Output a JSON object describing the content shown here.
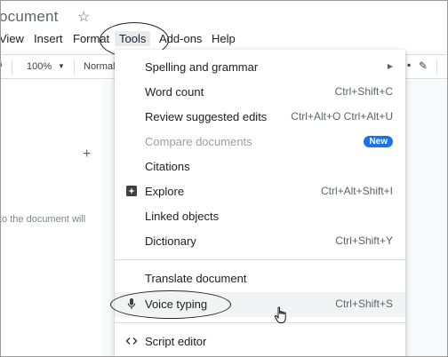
{
  "doc": {
    "title": "ocument"
  },
  "menubar": {
    "view": "View",
    "insert": "Insert",
    "format": "Format",
    "tools": "Tools",
    "addons": "Add-ons",
    "help": "Help"
  },
  "toolbar": {
    "zoom": "100%",
    "style": "Normal"
  },
  "outline": {
    "hint": "to the document will"
  },
  "tools_menu": {
    "items": [
      {
        "label": "Spelling and grammar",
        "shortcut": ""
      },
      {
        "label": "Word count",
        "shortcut": "Ctrl+Shift+C"
      },
      {
        "label": "Review suggested edits",
        "shortcut": "Ctrl+Alt+O Ctrl+Alt+U"
      },
      {
        "label": "Compare documents",
        "badge": "New"
      },
      {
        "label": "Citations",
        "shortcut": ""
      },
      {
        "label": "Explore",
        "shortcut": "Ctrl+Alt+Shift+I"
      },
      {
        "label": "Linked objects",
        "shortcut": ""
      },
      {
        "label": "Dictionary",
        "shortcut": "Ctrl+Shift+Y"
      },
      {
        "label": "Translate document",
        "shortcut": ""
      },
      {
        "label": "Voice typing",
        "shortcut": "Ctrl+Shift+S"
      },
      {
        "label": "Script editor",
        "shortcut": ""
      }
    ]
  },
  "colors": {
    "badge": "#1a73e8",
    "hover": "#f1f3f4",
    "disabled": "#9aa0a6"
  },
  "icons": {
    "explore": "explore-icon",
    "voice": "microphone-icon",
    "script": "code-brackets-icon",
    "submenu": "submenu-arrow-icon"
  }
}
